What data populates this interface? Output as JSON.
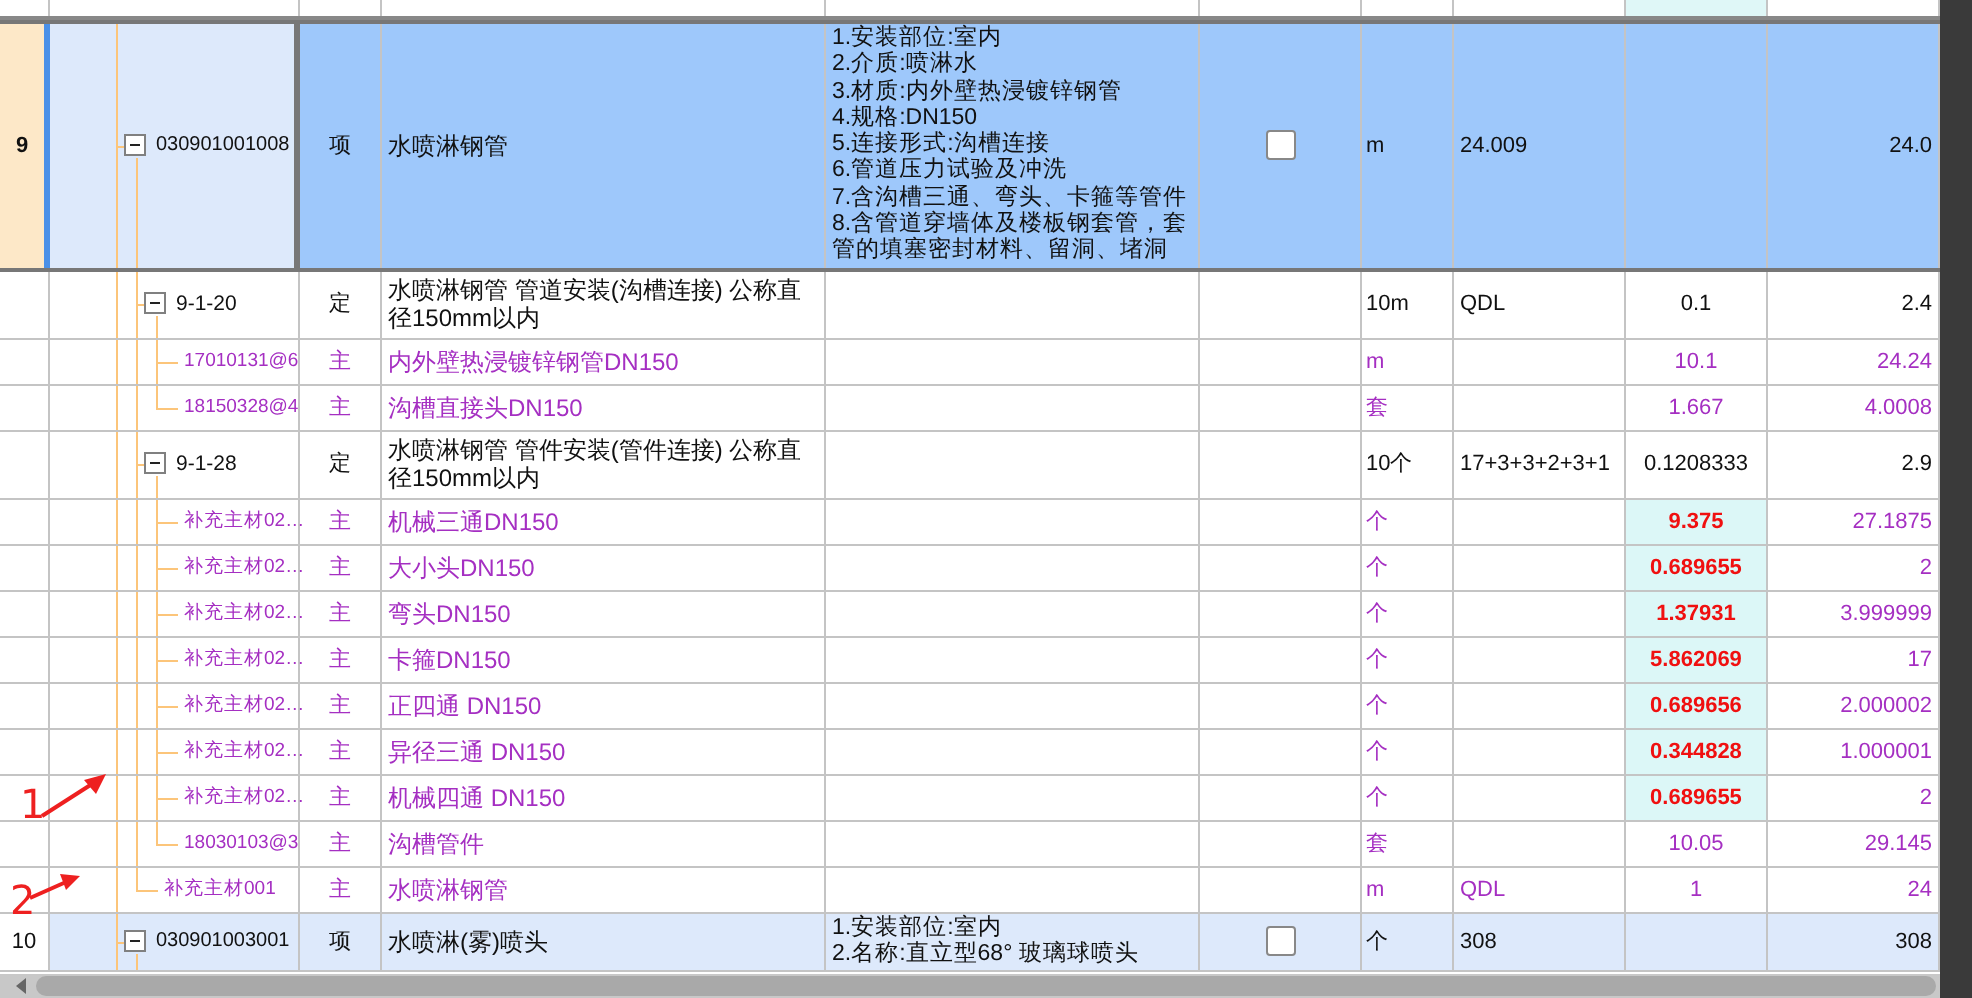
{
  "rows": [
    {
      "kind": "item",
      "num": "9",
      "code": "030901001008",
      "type": "项",
      "name": "水喷淋钢管",
      "features": [
        "1.安装部位:室内",
        "2.介质:喷淋水",
        "3.材质:内外壁热浸镀锌钢管",
        "4.规格:DN150",
        "5.连接形式:沟槽连接",
        "6.管道压力试验及冲洗",
        "7.含沟槽三通、弯头、卡箍等管件",
        "8.含管道穿墙体及楼板钢套管，套管的填塞密封材料、留洞、堵洞"
      ],
      "checked": false,
      "unit": "m",
      "expr": "24.009",
      "qty": "24.0",
      "selected": true,
      "expanded": true,
      "children": [
        {
          "kind": "quota",
          "code": "9-1-20",
          "type": "定",
          "name": "水喷淋钢管 管道安装(沟槽连接) 公称直径150mm以内",
          "unit": "10m",
          "expr": "QDL",
          "content": "0.1",
          "flagged": false,
          "qty": "2.4",
          "expanded": true,
          "children": [
            {
              "kind": "material",
              "code": "17010131@6",
              "type": "主",
              "name": "内外壁热浸镀锌钢管DN150",
              "unit": "m",
              "content": "10.1",
              "flagged": false,
              "qty": "24.24"
            },
            {
              "kind": "material",
              "code": "18150328@4",
              "type": "主",
              "name": "沟槽直接头DN150",
              "unit": "套",
              "content": "1.667",
              "flagged": false,
              "qty": "4.0008"
            }
          ]
        },
        {
          "kind": "quota",
          "code": "9-1-28",
          "type": "定",
          "name": "水喷淋钢管 管件安装(管件连接) 公称直径150mm以内",
          "unit": "10个",
          "expr": "17+3+3+2+3+1",
          "content": "0.1208333",
          "flagged": false,
          "qty": "2.9",
          "expanded": true,
          "children": [
            {
              "kind": "material",
              "code": "补充主材02…",
              "type": "主",
              "name": "机械三通DN150",
              "unit": "个",
              "content": "9.375",
              "flagged": true,
              "qty": "27.1875"
            },
            {
              "kind": "material",
              "code": "补充主材02…",
              "type": "主",
              "name": "大小头DN150",
              "unit": "个",
              "content": "0.689655",
              "flagged": true,
              "qty": "2"
            },
            {
              "kind": "material",
              "code": "补充主材02…",
              "type": "主",
              "name": "弯头DN150",
              "unit": "个",
              "content": "1.37931",
              "flagged": true,
              "qty": "3.999999"
            },
            {
              "kind": "material",
              "code": "补充主材02…",
              "type": "主",
              "name": "卡箍DN150",
              "unit": "个",
              "content": "5.862069",
              "flagged": true,
              "qty": "17"
            },
            {
              "kind": "material",
              "code": "补充主材02…",
              "type": "主",
              "name": "正四通 DN150",
              "unit": "个",
              "content": "0.689656",
              "flagged": true,
              "qty": "2.000002"
            },
            {
              "kind": "material",
              "code": "补充主材02…",
              "type": "主",
              "name": "异径三通 DN150",
              "unit": "个",
              "content": "0.344828",
              "flagged": true,
              "qty": "1.000001"
            },
            {
              "kind": "material",
              "code": "补充主材02…",
              "type": "主",
              "name": "机械四通 DN150",
              "unit": "个",
              "content": "0.689655",
              "flagged": true,
              "qty": "2"
            },
            {
              "kind": "material",
              "code": "18030103@3",
              "type": "主",
              "name": "沟槽管件",
              "unit": "套",
              "content": "10.05",
              "flagged": false,
              "qty": "29.145"
            }
          ]
        },
        {
          "kind": "material",
          "code": "补充主材001",
          "type": "主",
          "name": "水喷淋钢管",
          "unit": "m",
          "expr": "QDL",
          "content": "1",
          "flagged": false,
          "qty": "24"
        }
      ]
    },
    {
      "kind": "item",
      "num": "10",
      "code": "030901003001",
      "type": "项",
      "name": "水喷淋(雾)喷头",
      "features": [
        "1.安装部位:室内",
        "2.名称:直立型68° 玻璃球喷头"
      ],
      "checked": false,
      "unit": "个",
      "expr": "308",
      "qty": "308",
      "selected": false,
      "expanded": true
    }
  ],
  "annotations": [
    {
      "label": "1"
    },
    {
      "label": "2"
    }
  ]
}
